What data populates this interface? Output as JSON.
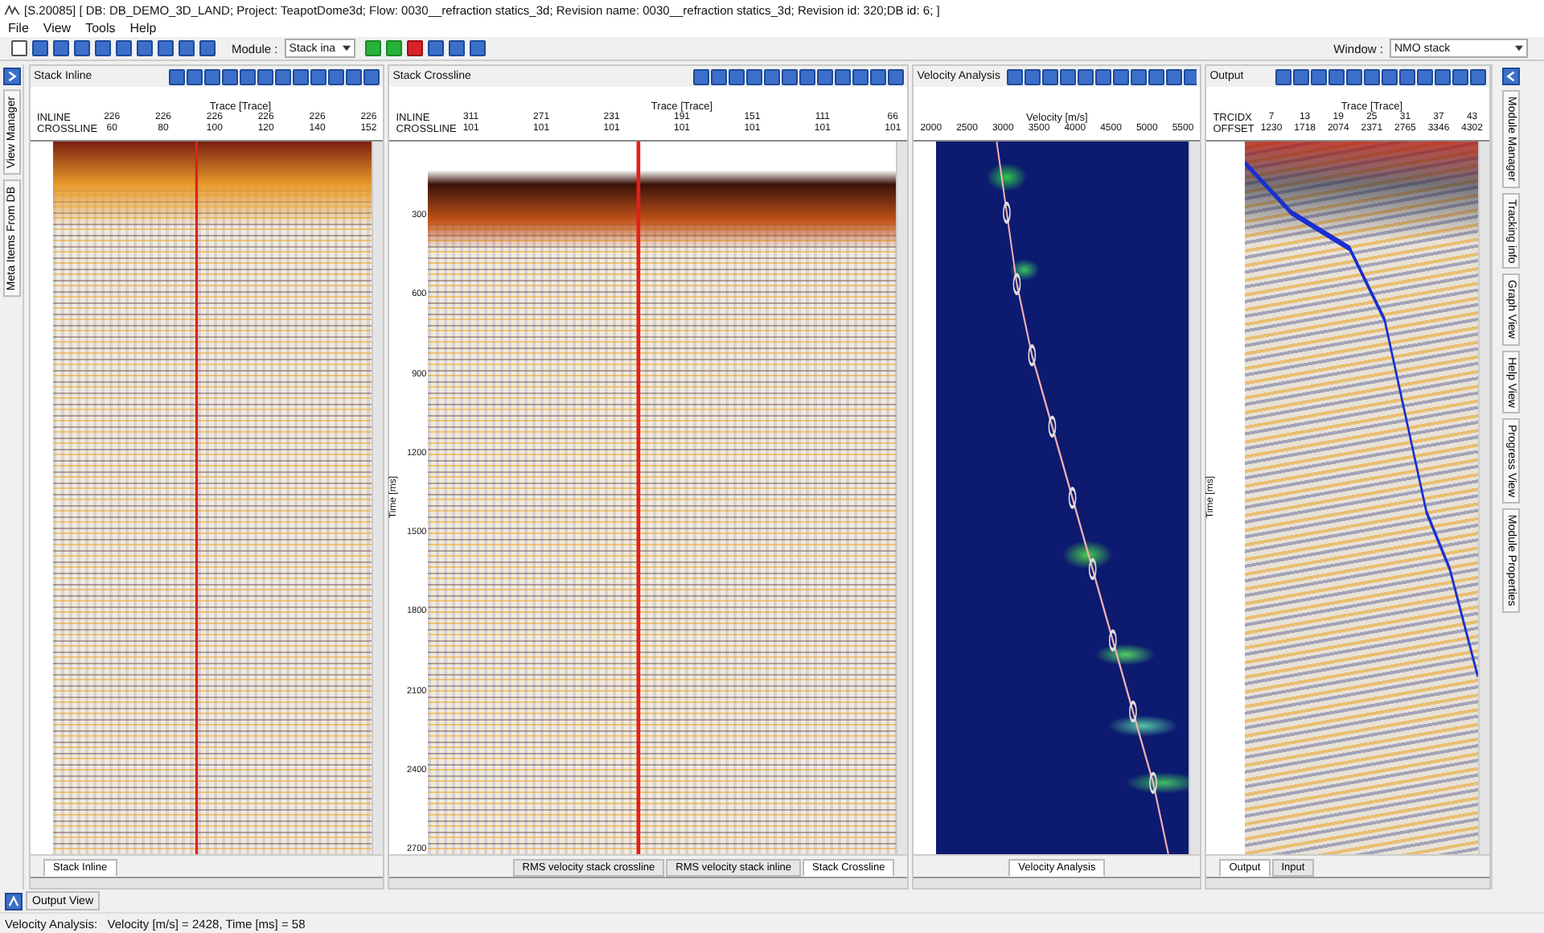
{
  "window": {
    "title": "[S.20085] [ DB: DB_DEMO_3D_LAND; Project: TeapotDome3d; Flow: 0030__refraction statics_3d; Revision name: 0030__refraction statics_3d; Revision id: 320;DB id: 6; ]"
  },
  "menu": [
    "File",
    "View",
    "Tools",
    "Help"
  ],
  "toolbar": {
    "module_label": "Module :",
    "module_value": "Stack ina",
    "window_label": "Window :",
    "window_value": "NMO stack"
  },
  "left_dock": [
    "View Manager",
    "Meta Items From DB"
  ],
  "right_dock": [
    "Module Manager",
    "Tracking info",
    "Graph View",
    "Help View",
    "Progress View",
    "Module Properties"
  ],
  "panels": [
    {
      "kind": "seismic",
      "title": "Stack Inline",
      "axis_title": "Trace [Trace]",
      "key_labels": [
        "INLINE",
        "CROSSLINE"
      ],
      "columns": [
        [
          "226",
          "60"
        ],
        [
          "226",
          "80"
        ],
        [
          "226",
          "100"
        ],
        [
          "226",
          "120"
        ],
        [
          "226",
          "140"
        ],
        [
          "226",
          "152"
        ]
      ],
      "tabs": [
        {
          "label": "Stack Inline",
          "selected": true
        }
      ]
    },
    {
      "kind": "seismic",
      "title": "Stack Crossline",
      "axis_title": "Trace [Trace]",
      "key_labels": [
        "INLINE",
        "CROSSLINE"
      ],
      "columns": [
        [
          "311",
          "101"
        ],
        [
          "271",
          "101"
        ],
        [
          "231",
          "101"
        ],
        [
          "191",
          "101"
        ],
        [
          "151",
          "101"
        ],
        [
          "111",
          "101"
        ],
        [
          "66",
          "101"
        ]
      ],
      "time_label": "Time [ms]",
      "time_ticks": [
        "300",
        "600",
        "900",
        "1200",
        "1500",
        "1800",
        "2100",
        "2400",
        "2700"
      ],
      "tabs": [
        {
          "label": "RMS velocity stack crossline",
          "selected": false
        },
        {
          "label": "RMS velocity stack inline",
          "selected": false
        },
        {
          "label": "Stack Crossline",
          "selected": true
        }
      ]
    },
    {
      "kind": "velocity",
      "title": "Velocity Analysis",
      "axis_title": "Velocity [m/s]",
      "columns": [
        [
          "2000"
        ],
        [
          "2500"
        ],
        [
          "3000"
        ],
        [
          "3500"
        ],
        [
          "4000"
        ],
        [
          "4500"
        ],
        [
          "5000"
        ],
        [
          "5500"
        ]
      ],
      "tabs": [
        {
          "label": "Velocity Analysis",
          "selected": true
        }
      ]
    },
    {
      "kind": "gather",
      "title": "Output",
      "axis_title": "Trace [Trace]",
      "key_labels": [
        "TRCIDX",
        "OFFSET"
      ],
      "columns": [
        [
          "7",
          "1230"
        ],
        [
          "13",
          "1718"
        ],
        [
          "19",
          "2074"
        ],
        [
          "25",
          "2371"
        ],
        [
          "31",
          "2765"
        ],
        [
          "37",
          "3346"
        ],
        [
          "43",
          "4302"
        ]
      ],
      "time_label": "Time [ms]",
      "tabs": [
        {
          "label": "Output",
          "selected": true
        },
        {
          "label": "Input",
          "selected": false
        }
      ]
    }
  ],
  "output_view": "Output View",
  "status_bar": "Velocity Analysis:   Velocity [m/s] = 2428, Time [ms] = 58"
}
